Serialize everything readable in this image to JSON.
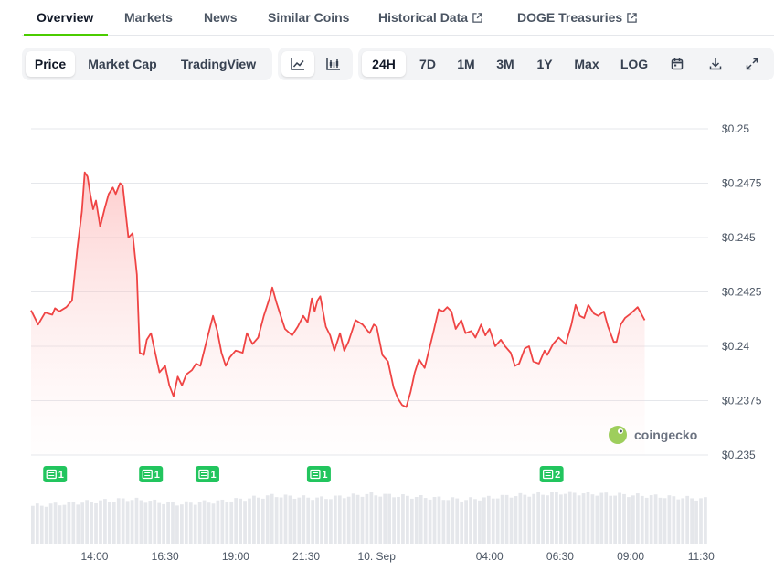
{
  "tabs": [
    {
      "label": "Overview",
      "active": true
    },
    {
      "label": "Markets"
    },
    {
      "label": "News"
    },
    {
      "label": "Similar Coins"
    },
    {
      "label": "Historical Data",
      "external": true
    },
    {
      "label": "DOGE Treasuries",
      "external": true
    }
  ],
  "toolbar": {
    "view_buttons": [
      {
        "label": "Price",
        "active": true
      },
      {
        "label": "Market Cap"
      },
      {
        "label": "TradingView"
      }
    ],
    "chart_type_buttons": [
      {
        "icon": "line-chart-icon",
        "active": true
      },
      {
        "icon": "candlestick-chart-icon"
      }
    ],
    "range_buttons": [
      {
        "label": "24H",
        "active": true
      },
      {
        "label": "7D"
      },
      {
        "label": "1M"
      },
      {
        "label": "3M"
      },
      {
        "label": "1Y"
      },
      {
        "label": "Max"
      },
      {
        "label": "LOG"
      }
    ],
    "action_icons": [
      "calendar-icon",
      "download-icon",
      "fullscreen-icon"
    ]
  },
  "watermark": "coingecko",
  "colors": {
    "line": "#ef4444",
    "area": "#fecaca",
    "grid": "#e5e7eb",
    "volume": "#e5e7eb",
    "news_badge": "#22c55e",
    "active_tab_underline": "#4bcc00"
  },
  "chart_data": {
    "type": "line",
    "title": "",
    "xlabel": "",
    "ylabel": "",
    "y_tick_labels": [
      "$0.25",
      "$0.2475",
      "$0.245",
      "$0.2425",
      "$0.24",
      "$0.2375",
      "$0.235"
    ],
    "y_ticks": [
      0.25,
      0.2475,
      0.245,
      0.2425,
      0.24,
      0.2375,
      0.235
    ],
    "ylim": [
      0.235,
      0.25
    ],
    "x_tick_labels": [
      "14:00",
      "16:30",
      "19:00",
      "21:30",
      "10. Sep",
      "04:00",
      "06:30",
      "09:00",
      "11:30"
    ],
    "x_tick_hours": [
      14,
      16.5,
      19,
      21.5,
      24,
      28,
      30.5,
      33,
      35.5
    ],
    "xlim_hours": [
      11.75,
      35.75
    ],
    "grid": true,
    "series": [
      {
        "values": [
          [
            11.75,
            0.24165
          ],
          [
            12.0,
            0.241
          ],
          [
            12.25,
            0.24155
          ],
          [
            12.5,
            0.24145
          ],
          [
            12.6,
            0.24175
          ],
          [
            12.75,
            0.2416
          ],
          [
            13.0,
            0.2418
          ],
          [
            13.2,
            0.2421
          ],
          [
            13.4,
            0.2446
          ],
          [
            13.55,
            0.2462
          ],
          [
            13.65,
            0.248
          ],
          [
            13.75,
            0.2478
          ],
          [
            13.85,
            0.247
          ],
          [
            13.95,
            0.2463
          ],
          [
            14.05,
            0.2467
          ],
          [
            14.2,
            0.2455
          ],
          [
            14.35,
            0.2463
          ],
          [
            14.5,
            0.247
          ],
          [
            14.65,
            0.2473
          ],
          [
            14.75,
            0.247
          ],
          [
            14.9,
            0.2475
          ],
          [
            15.0,
            0.2474
          ],
          [
            15.2,
            0.245
          ],
          [
            15.35,
            0.2452
          ],
          [
            15.5,
            0.2433
          ],
          [
            15.6,
            0.2397
          ],
          [
            15.75,
            0.2396
          ],
          [
            15.85,
            0.2403
          ],
          [
            16.0,
            0.2406
          ],
          [
            16.1,
            0.24
          ],
          [
            16.3,
            0.2388
          ],
          [
            16.5,
            0.2391
          ],
          [
            16.65,
            0.2382
          ],
          [
            16.8,
            0.2377
          ],
          [
            16.95,
            0.2386
          ],
          [
            17.1,
            0.2382
          ],
          [
            17.25,
            0.2387
          ],
          [
            17.45,
            0.2389
          ],
          [
            17.6,
            0.2392
          ],
          [
            17.75,
            0.2391
          ],
          [
            18.0,
            0.2404
          ],
          [
            18.2,
            0.2414
          ],
          [
            18.35,
            0.2407
          ],
          [
            18.5,
            0.2397
          ],
          [
            18.65,
            0.2391
          ],
          [
            18.8,
            0.2395
          ],
          [
            19.0,
            0.2398
          ],
          [
            19.25,
            0.2397
          ],
          [
            19.4,
            0.2406
          ],
          [
            19.6,
            0.2401
          ],
          [
            19.8,
            0.2404
          ],
          [
            20.0,
            0.2414
          ],
          [
            20.2,
            0.2422
          ],
          [
            20.3,
            0.2427
          ],
          [
            20.45,
            0.242
          ],
          [
            20.6,
            0.2414
          ],
          [
            20.75,
            0.2408
          ],
          [
            21.0,
            0.2405
          ],
          [
            21.2,
            0.2409
          ],
          [
            21.4,
            0.2414
          ],
          [
            21.55,
            0.2411
          ],
          [
            21.7,
            0.2422
          ],
          [
            21.8,
            0.2416
          ],
          [
            21.9,
            0.2421
          ],
          [
            22.0,
            0.2423
          ],
          [
            22.2,
            0.2409
          ],
          [
            22.35,
            0.2405
          ],
          [
            22.5,
            0.2398
          ],
          [
            22.7,
            0.2406
          ],
          [
            22.85,
            0.2398
          ],
          [
            23.0,
            0.2402
          ],
          [
            23.25,
            0.2412
          ],
          [
            23.5,
            0.241
          ],
          [
            23.75,
            0.2406
          ],
          [
            23.9,
            0.241
          ],
          [
            24.0,
            0.2409
          ],
          [
            24.2,
            0.2396
          ],
          [
            24.4,
            0.2393
          ],
          [
            24.6,
            0.2381
          ],
          [
            24.75,
            0.2376
          ],
          [
            24.9,
            0.2373
          ],
          [
            25.05,
            0.2372
          ],
          [
            25.2,
            0.2379
          ],
          [
            25.35,
            0.2388
          ],
          [
            25.5,
            0.2394
          ],
          [
            25.7,
            0.239
          ],
          [
            25.85,
            0.2398
          ],
          [
            26.0,
            0.2406
          ],
          [
            26.2,
            0.2417
          ],
          [
            26.35,
            0.2416
          ],
          [
            26.5,
            0.2418
          ],
          [
            26.65,
            0.2416
          ],
          [
            26.8,
            0.2408
          ],
          [
            27.0,
            0.2412
          ],
          [
            27.15,
            0.2406
          ],
          [
            27.35,
            0.2407
          ],
          [
            27.5,
            0.2404
          ],
          [
            27.7,
            0.241
          ],
          [
            27.85,
            0.2405
          ],
          [
            28.0,
            0.2408
          ],
          [
            28.2,
            0.24
          ],
          [
            28.4,
            0.2403
          ],
          [
            28.55,
            0.24
          ],
          [
            28.75,
            0.2397
          ],
          [
            28.9,
            0.2391
          ],
          [
            29.05,
            0.2392
          ],
          [
            29.25,
            0.2399
          ],
          [
            29.4,
            0.24
          ],
          [
            29.55,
            0.2393
          ],
          [
            29.75,
            0.2392
          ],
          [
            29.95,
            0.2398
          ],
          [
            30.05,
            0.2396
          ],
          [
            30.25,
            0.2401
          ],
          [
            30.45,
            0.2404
          ],
          [
            30.7,
            0.2401
          ],
          [
            30.9,
            0.241
          ],
          [
            31.05,
            0.2419
          ],
          [
            31.2,
            0.2414
          ],
          [
            31.35,
            0.2413
          ],
          [
            31.5,
            0.2419
          ],
          [
            31.7,
            0.2415
          ],
          [
            31.85,
            0.2414
          ],
          [
            32.05,
            0.2416
          ],
          [
            32.2,
            0.2409
          ],
          [
            32.4,
            0.2402
          ],
          [
            32.5,
            0.2402
          ],
          [
            32.65,
            0.241
          ],
          [
            32.8,
            0.2413
          ],
          [
            33.0,
            0.2415
          ],
          [
            33.25,
            0.2418
          ],
          [
            33.5,
            0.2412
          ]
        ]
      }
    ],
    "volume_levels": [
      0.55,
      0.6,
      0.65,
      0.58,
      0.62,
      0.7,
      0.66,
      0.72,
      0.68,
      0.64,
      0.7,
      0.74,
      0.72,
      0.69,
      0.65
    ],
    "news_events": [
      {
        "hour": 12.6,
        "count": 1
      },
      {
        "hour": 16.0,
        "count": 1
      },
      {
        "hour": 18.0,
        "count": 1
      },
      {
        "hour": 21.95,
        "count": 1
      },
      {
        "hour": 30.2,
        "count": 2
      }
    ]
  }
}
